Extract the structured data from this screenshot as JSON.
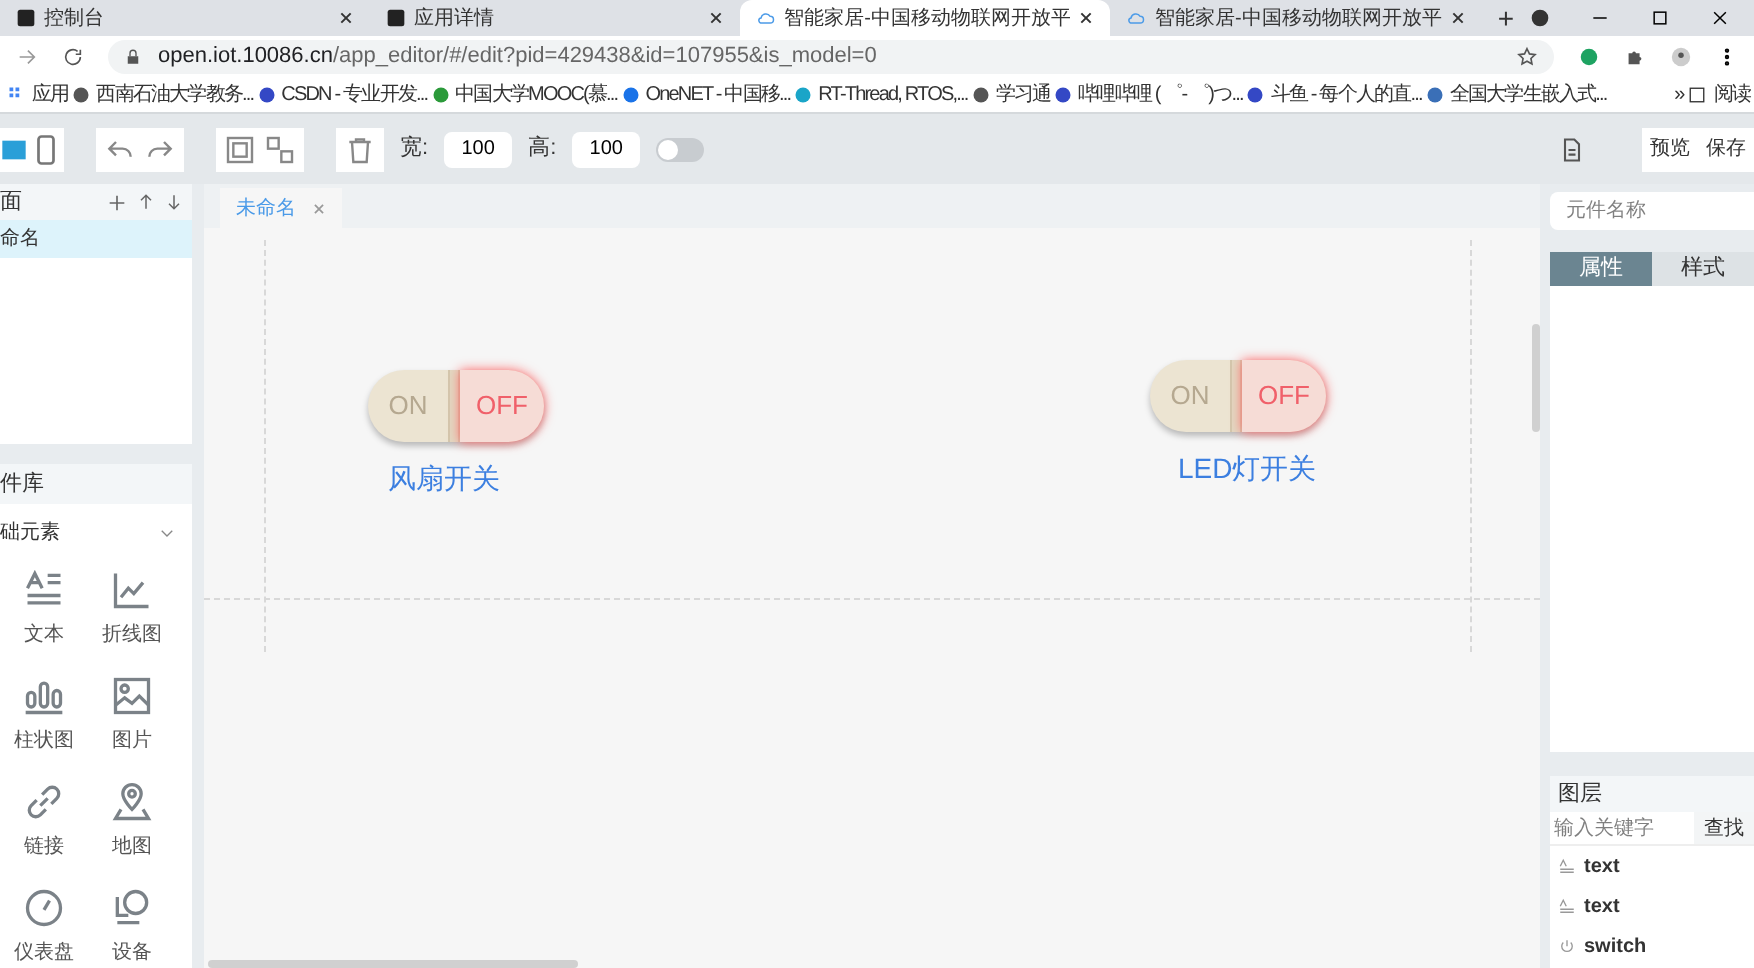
{
  "browser": {
    "tabs": [
      {
        "title": "控制台",
        "selected": false
      },
      {
        "title": "应用详情",
        "selected": false
      },
      {
        "title": "智能家居-中国移动物联网开放平",
        "selected": true
      },
      {
        "title": "智能家居-中国移动物联网开放平",
        "selected": false
      }
    ],
    "new_tab": "+",
    "url_host": "open.iot.10086.cn",
    "url_path": "/app_editor/#/edit?pid=429438&id=107955&is_model=0",
    "bookmarks": [
      "应用",
      "西南石油大学教务...",
      "CSDN - 专业开发...",
      "中国大学MOOC(慕...",
      "OneNET - 中国移...",
      "RT-Thread, RTOS,...",
      "学习通",
      "哔哩哔哩 ( ゜- ゜)つ...",
      "斗鱼 - 每个人的直...",
      "全国大学生嵌入式..."
    ],
    "more": "»",
    "reading_list": "阅读"
  },
  "toolbar": {
    "width_label": "宽:",
    "width_value": "100",
    "height_label": "高:",
    "height_value": "100",
    "lock_on": false,
    "preview": "预览",
    "save": "保存"
  },
  "pages_panel": {
    "title": "面",
    "items": [
      {
        "label": "命名",
        "selected": true
      }
    ]
  },
  "library": {
    "title": "件库",
    "category": "础元素",
    "items": [
      "文本",
      "折线图",
      "柱状图",
      "图片",
      "链接",
      "地图",
      "仪表盘",
      "设备"
    ]
  },
  "canvas": {
    "tab": "未命名",
    "switches": [
      {
        "on_text": "ON",
        "off_text": "OFF",
        "on": false,
        "label": "风扇开关"
      },
      {
        "on_text": "ON",
        "off_text": "OFF",
        "on": false,
        "label": "LED灯开关"
      }
    ]
  },
  "right_panel": {
    "name_placeholder": "元件名称",
    "tabs": [
      {
        "label": "属性",
        "selected": true
      },
      {
        "label": "样式",
        "selected": false
      }
    ],
    "layers_title": "图层",
    "search_placeholder": "输入关键字",
    "search_button": "查找",
    "layers": [
      {
        "kind": "text",
        "label": "text"
      },
      {
        "kind": "text",
        "label": "text"
      },
      {
        "kind": "switch",
        "label": "switch"
      }
    ]
  }
}
